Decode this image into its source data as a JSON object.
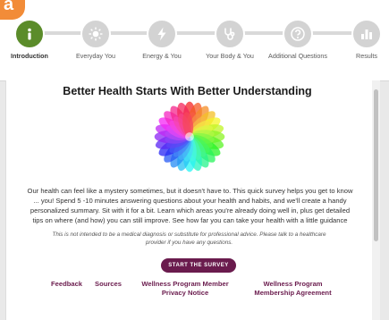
{
  "corner_badge": "a",
  "steps": [
    {
      "label": "Introduction",
      "icon": "info-icon",
      "active": true
    },
    {
      "label": "Everyday You",
      "icon": "sun-icon",
      "active": false
    },
    {
      "label": "Energy & You",
      "icon": "lightning-icon",
      "active": false
    },
    {
      "label": "Your Body & You",
      "icon": "stethoscope-icon",
      "active": false
    },
    {
      "label": "Additional Questions",
      "icon": "question-icon",
      "active": false
    },
    {
      "label": "Results",
      "icon": "bar-chart-icon",
      "active": false
    }
  ],
  "page": {
    "title": "Better Health Starts With Better Understanding",
    "intro": "Our health can feel like a mystery sometimes, but it doesn't have to. This quick survey helps you get to know ... you! Spend 5 -10 minutes answering questions about your health and habits, and we'll create a handy personalized summary. Sit with it for a bit. Learn which areas you're already doing well in, plus get detailed tips on where (and how) you can still improve. See how far you can take your health with a little guidance",
    "disclaimer": "This is not intended to be a medical diagnosis or substitute for professional advice. Please talk to a healthcare provider if you have any questions.",
    "start_button": "START THE SURVEY"
  },
  "footer": {
    "feedback": "Feedback",
    "sources": "Sources",
    "privacy_line1": "Wellness Program Member",
    "privacy_line2": "Privacy Notice",
    "agreement_line1": "Wellness Program",
    "agreement_line2": "Membership Agreement"
  },
  "colors": {
    "accent_green": "#5b8c2a",
    "button_purple": "#6a1b4d",
    "badge_orange": "#f28c38"
  }
}
